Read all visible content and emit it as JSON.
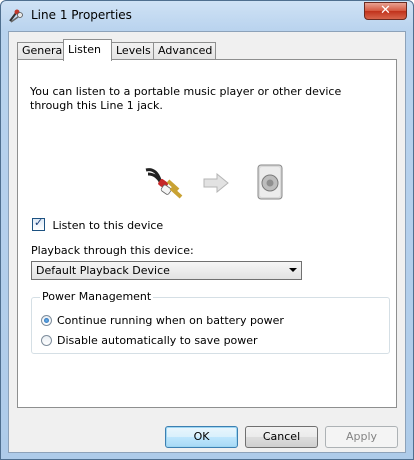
{
  "window": {
    "title": "Line 1 Properties",
    "close_glyph": "✕"
  },
  "tabs": [
    {
      "label": "General"
    },
    {
      "label": "Listen"
    },
    {
      "label": "Levels"
    },
    {
      "label": "Advanced"
    }
  ],
  "listen": {
    "description": "You can listen to a portable music player or other device through this Line 1 jack.",
    "icons": [
      "rca-cable-icon",
      "arrow-right-icon",
      "speaker-icon"
    ],
    "listen_checkbox_label": "Listen to this device",
    "listen_checked": true,
    "playback_label": "Playback through this device:",
    "playback_device": "Default Playback Device",
    "power_group_title": "Power Management",
    "power_options": [
      {
        "label": "Continue running when on battery power",
        "selected": true
      },
      {
        "label": "Disable automatically to save power",
        "selected": false
      }
    ]
  },
  "buttons": {
    "ok": "OK",
    "cancel": "Cancel",
    "apply": "Apply"
  }
}
